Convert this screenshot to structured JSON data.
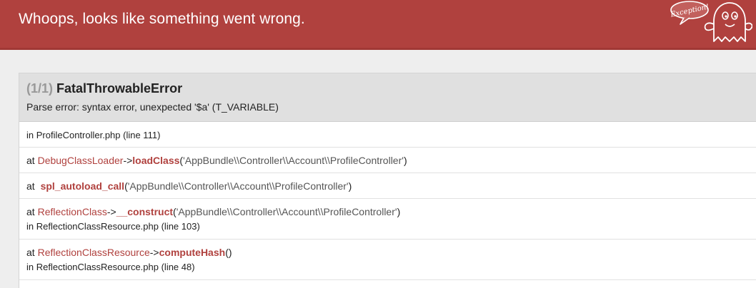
{
  "header": {
    "title": "Whoops, looks like something went wrong.",
    "mascot_label": "Exception!"
  },
  "error": {
    "counter": "(1/1)",
    "type": "FatalThrowableError",
    "message": "Parse error: syntax error, unexpected '$a' (T_VARIABLE)"
  },
  "trace": [
    {
      "location": "in ProfileController.php (line 111)"
    },
    {
      "prefix": "at",
      "class": "DebugClassLoader",
      "arrow": "->",
      "function": "loadClass",
      "open": "(",
      "args": "'AppBundle\\\\Controller\\\\Account\\\\ProfileController'",
      "close": ")"
    },
    {
      "prefix": "at",
      "function": "spl_autoload_call",
      "open": "(",
      "args": "'AppBundle\\\\Controller\\\\Account\\\\ProfileController'",
      "close": ")"
    },
    {
      "prefix": "at",
      "class": "ReflectionClass",
      "arrow": "->",
      "function": "__construct",
      "open": "(",
      "args": "'AppBundle\\\\Controller\\\\Account\\\\ProfileController'",
      "close": ")",
      "location": "in ReflectionClassResource.php (line 103)"
    },
    {
      "prefix": "at",
      "class": "ReflectionClassResource",
      "arrow": "->",
      "function": "computeHash",
      "open": "(",
      "close": ")",
      "location": "in ReflectionClassResource.php (line 48)"
    }
  ],
  "colors": {
    "header_bg": "#b0413e",
    "accent": "#b0413e",
    "panel_head_bg": "#e0e0e0",
    "page_bg": "#eeeeee"
  },
  "icons": {
    "mascot": "ghost-mascot-icon"
  }
}
